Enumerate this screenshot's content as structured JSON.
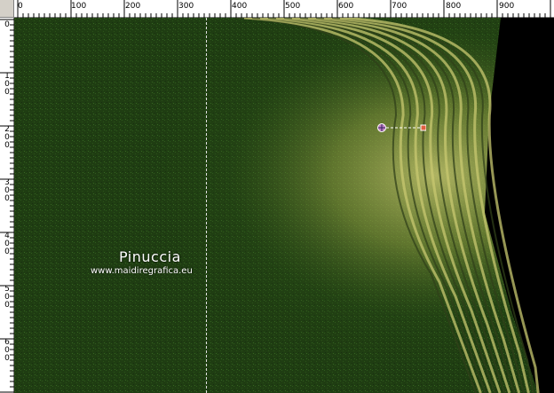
{
  "rulers": {
    "top_labels": [
      "0",
      "100",
      "200",
      "300",
      "400",
      "500",
      "600",
      "700",
      "800",
      "900"
    ],
    "left_labels": [
      "0",
      "100",
      "200",
      "300",
      "400",
      "500",
      "600"
    ]
  },
  "watermark": {
    "name": "Pinuccia",
    "url": "www.maidiregrafica.eu"
  },
  "colors": {
    "canvas_green": "#1f3d12",
    "wave_yellow": "#c8c870",
    "ruler_bg": "#ffffff",
    "frame_gray": "#d4d0c8"
  },
  "tool": {
    "handle_icon": "gradient-handle-icon",
    "end_icon": "gradient-end-icon"
  }
}
